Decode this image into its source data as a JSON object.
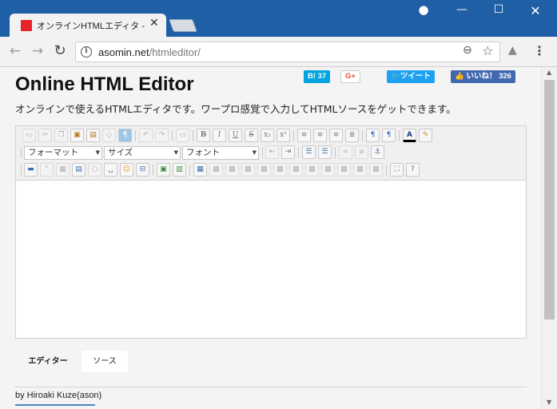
{
  "browser": {
    "tab_title": "オンラインHTMLエディタ - O",
    "tab_close": "✕",
    "url_host": "asomin.net",
    "url_path": "/htmleditor/",
    "accent_color": "#1f5fa6"
  },
  "page": {
    "title": "Online HTML Editor",
    "description": "オンラインで使えるHTMLエディタです。ワープロ感覚で入力してHTMLソースをゲットできます。",
    "social": {
      "hatena": "B! 37",
      "gplus": "G+",
      "tweet": "ツイート",
      "like": "いいね！ 326"
    },
    "editor": {
      "format_select": "フォーマット",
      "size_select": "サイズ",
      "font_select": "フォント"
    },
    "mode_tabs": {
      "editor": "エディター",
      "source": "ソース"
    },
    "footer": "by Hiroaki Kuze(ason)"
  }
}
